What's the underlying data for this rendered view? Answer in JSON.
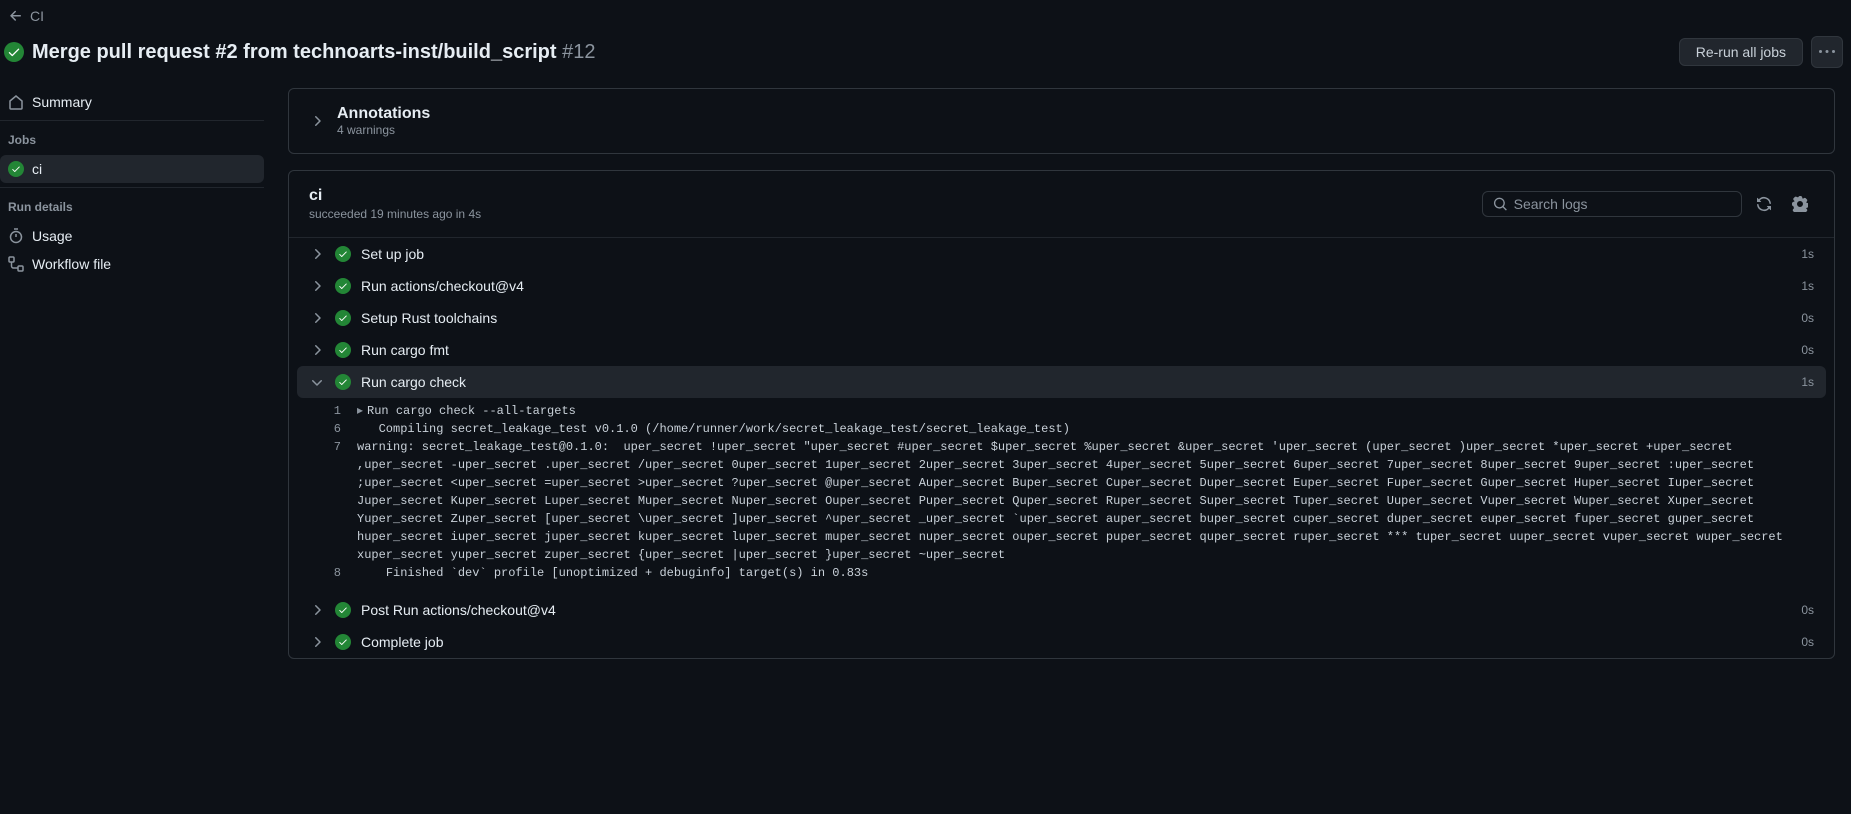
{
  "breadcrumb": {
    "workflow": "CI"
  },
  "run": {
    "title": "Merge pull request #2 from technoarts-inst/build_script",
    "number": "#12",
    "rerun_label": "Re-run all jobs"
  },
  "sidebar": {
    "summary_label": "Summary",
    "jobs_heading": "Jobs",
    "jobs": [
      {
        "name": "ci",
        "status": "success"
      }
    ],
    "details_heading": "Run details",
    "usage_label": "Usage",
    "workflow_file_label": "Workflow file"
  },
  "annotations": {
    "title": "Annotations",
    "subtitle": "4 warnings"
  },
  "job": {
    "name": "ci",
    "status_line": "succeeded 19 minutes ago in 4s",
    "search_placeholder": "Search logs",
    "steps": [
      {
        "name": "Set up job",
        "duration": "1s",
        "expanded": false
      },
      {
        "name": "Run actions/checkout@v4",
        "duration": "1s",
        "expanded": false
      },
      {
        "name": "Setup Rust toolchains",
        "duration": "0s",
        "expanded": false
      },
      {
        "name": "Run cargo fmt",
        "duration": "0s",
        "expanded": false
      },
      {
        "name": "Run cargo check",
        "duration": "1s",
        "expanded": true
      },
      {
        "name": "Post Run actions/checkout@v4",
        "duration": "0s",
        "expanded": false
      },
      {
        "name": "Complete job",
        "duration": "0s",
        "expanded": false
      }
    ],
    "logs": [
      {
        "n": "1",
        "caret": true,
        "text": "Run cargo check --all-targets"
      },
      {
        "n": "6",
        "text": "   Compiling secret_leakage_test v0.1.0 (/home/runner/work/secret_leakage_test/secret_leakage_test)"
      },
      {
        "n": "7",
        "text": "warning: secret_leakage_test@0.1.0:  uper_secret !uper_secret \"uper_secret #uper_secret $uper_secret %uper_secret &uper_secret 'uper_secret (uper_secret )uper_secret *uper_secret +uper_secret ,uper_secret -uper_secret .uper_secret /uper_secret 0uper_secret 1uper_secret 2uper_secret 3uper_secret 4uper_secret 5uper_secret 6uper_secret 7uper_secret 8uper_secret 9uper_secret :uper_secret ;uper_secret <uper_secret =uper_secret >uper_secret ?uper_secret @uper_secret Auper_secret Buper_secret Cuper_secret Duper_secret Euper_secret Fuper_secret Guper_secret Huper_secret Iuper_secret Juper_secret Kuper_secret Luper_secret Muper_secret Nuper_secret Ouper_secret Puper_secret Quper_secret Ruper_secret Super_secret Tuper_secret Uuper_secret Vuper_secret Wuper_secret Xuper_secret Yuper_secret Zuper_secret [uper_secret \\uper_secret ]uper_secret ^uper_secret _uper_secret `uper_secret auper_secret buper_secret cuper_secret duper_secret euper_secret fuper_secret guper_secret huper_secret iuper_secret juper_secret kuper_secret luper_secret muper_secret nuper_secret ouper_secret puper_secret quper_secret ruper_secret *** tuper_secret uuper_secret vuper_secret wuper_secret xuper_secret yuper_secret zuper_secret {uper_secret |uper_secret }uper_secret ~uper_secret"
      },
      {
        "n": "8",
        "text": "    Finished `dev` profile [unoptimized + debuginfo] target(s) in 0.83s"
      }
    ]
  }
}
